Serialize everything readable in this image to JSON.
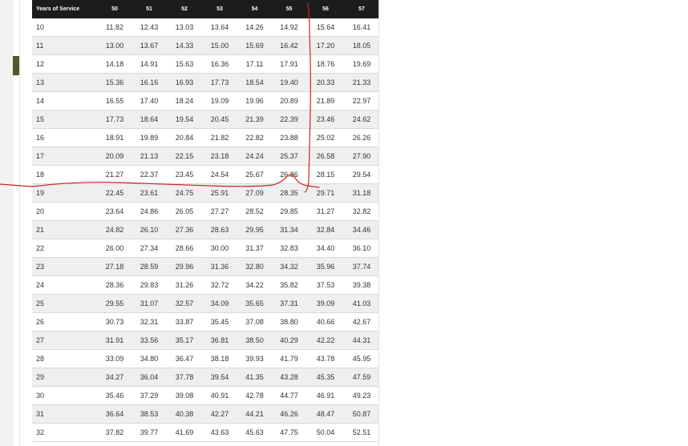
{
  "table": {
    "header_label": "Years of Service",
    "columns": [
      "50",
      "51",
      "52",
      "53",
      "54",
      "55",
      "56",
      "57"
    ],
    "rows": [
      {
        "years": "10",
        "values": [
          "11.82",
          "12.43",
          "13.03",
          "13.64",
          "14.26",
          "14.92",
          "15.64",
          "16.41"
        ]
      },
      {
        "years": "11",
        "values": [
          "13.00",
          "13.67",
          "14.33",
          "15.00",
          "15.69",
          "16.42",
          "17.20",
          "18.05"
        ]
      },
      {
        "years": "12",
        "values": [
          "14.18",
          "14.91",
          "15.63",
          "16.36",
          "17.11",
          "17.91",
          "18.76",
          "19.69"
        ]
      },
      {
        "years": "13",
        "values": [
          "15.36",
          "16.16",
          "16.93",
          "17.73",
          "18.54",
          "19.40",
          "20.33",
          "21.33"
        ]
      },
      {
        "years": "14",
        "values": [
          "16.55",
          "17.40",
          "18.24",
          "19.09",
          "19.96",
          "20.89",
          "21.89",
          "22.97"
        ]
      },
      {
        "years": "15",
        "values": [
          "17.73",
          "18.64",
          "19.54",
          "20.45",
          "21.39",
          "22.39",
          "23.46",
          "24.62"
        ]
      },
      {
        "years": "16",
        "values": [
          "18.91",
          "19.89",
          "20.84",
          "21.82",
          "22.82",
          "23.88",
          "25.02",
          "26.26"
        ]
      },
      {
        "years": "17",
        "values": [
          "20.09",
          "21.13",
          "22.15",
          "23.18",
          "24.24",
          "25.37",
          "26.58",
          "27.90"
        ]
      },
      {
        "years": "18",
        "values": [
          "21.27",
          "22.37",
          "23.45",
          "24.54",
          "25.67",
          "26.86",
          "28.15",
          "29.54"
        ]
      },
      {
        "years": "19",
        "values": [
          "22.45",
          "23.61",
          "24.75",
          "25.91",
          "27.09",
          "28.35",
          "29.71",
          "31.18"
        ]
      },
      {
        "years": "20",
        "values": [
          "23.64",
          "24.86",
          "26.05",
          "27.27",
          "28.52",
          "29.85",
          "31.27",
          "32.82"
        ]
      },
      {
        "years": "21",
        "values": [
          "24.82",
          "26.10",
          "27.36",
          "28.63",
          "29.95",
          "31.34",
          "32.84",
          "34.46"
        ]
      },
      {
        "years": "22",
        "values": [
          "26.00",
          "27.34",
          "28.66",
          "30.00",
          "31.37",
          "32.83",
          "34.40",
          "36.10"
        ]
      },
      {
        "years": "23",
        "values": [
          "27.18",
          "28.59",
          "29.96",
          "31.36",
          "32.80",
          "34.32",
          "35.96",
          "37.74"
        ]
      },
      {
        "years": "24",
        "values": [
          "28.36",
          "29.83",
          "31.26",
          "32.72",
          "34.22",
          "35.82",
          "37.53",
          "39.38"
        ]
      },
      {
        "years": "25",
        "values": [
          "29.55",
          "31.07",
          "32.57",
          "34.09",
          "35.65",
          "37.31",
          "39.09",
          "41.03"
        ]
      },
      {
        "years": "26",
        "values": [
          "30.73",
          "32.31",
          "33.87",
          "35.45",
          "37.08",
          "38.80",
          "40.66",
          "42.67"
        ]
      },
      {
        "years": "27",
        "values": [
          "31.91",
          "33.56",
          "35.17",
          "36.81",
          "38.50",
          "40.29",
          "42.22",
          "44.31"
        ]
      },
      {
        "years": "28",
        "values": [
          "33.09",
          "34.80",
          "36.47",
          "38.18",
          "39.93",
          "41.79",
          "43.78",
          "45.95"
        ]
      },
      {
        "years": "29",
        "values": [
          "34.27",
          "36.04",
          "37.78",
          "39.54",
          "41.35",
          "43.28",
          "45.35",
          "47.59"
        ]
      },
      {
        "years": "30",
        "values": [
          "35.46",
          "37.29",
          "39.08",
          "40.91",
          "42.78",
          "44.77",
          "46.91",
          "49.23"
        ]
      },
      {
        "years": "31",
        "values": [
          "36.64",
          "38.53",
          "40.38",
          "42.27",
          "44.21",
          "46.26",
          "48.47",
          "50.87"
        ]
      },
      {
        "years": "32",
        "values": [
          "37.82",
          "39.77",
          "41.69",
          "43.63",
          "45.63",
          "47.75",
          "50.04",
          "52.51"
        ]
      }
    ]
  },
  "colors": {
    "header_bg": "#1c1c1c",
    "header_text": "#ffffff",
    "row_alt_bg": "#efefef",
    "annotation_ink": "#d42020",
    "side_accent": "#4a5a2a"
  }
}
